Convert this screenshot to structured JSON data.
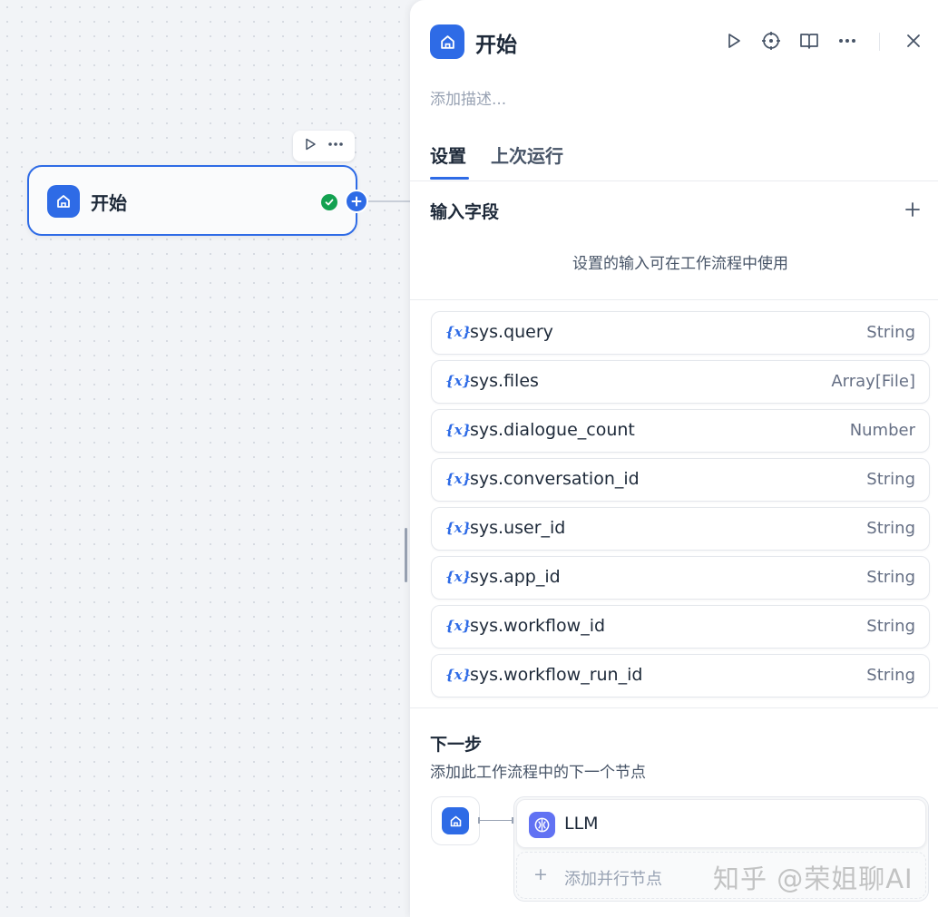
{
  "canvas": {
    "node_title": "开始"
  },
  "panel": {
    "title": "开始",
    "description_placeholder": "添加描述...",
    "tabs": [
      {
        "label": "设置",
        "active": true
      },
      {
        "label": "上次运行",
        "active": false
      }
    ],
    "input_section": {
      "title": "输入字段",
      "hint": "设置的输入可在工作流程中使用"
    },
    "variables": [
      {
        "icon": "{x}",
        "name": "sys.query",
        "type": "String"
      },
      {
        "icon": "{x}",
        "name": "sys.files",
        "type": "Array[File]"
      },
      {
        "icon": "{x}",
        "name": "sys.dialogue_count",
        "type": "Number"
      },
      {
        "icon": "{x}",
        "name": "sys.conversation_id",
        "type": "String"
      },
      {
        "icon": "{x}",
        "name": "sys.user_id",
        "type": "String"
      },
      {
        "icon": "{x}",
        "name": "sys.app_id",
        "type": "String"
      },
      {
        "icon": "{x}",
        "name": "sys.workflow_id",
        "type": "String"
      },
      {
        "icon": "{x}",
        "name": "sys.workflow_run_id",
        "type": "String"
      }
    ],
    "next_step": {
      "title": "下一步",
      "description": "添加此工作流程中的下一个节点",
      "next_node": "LLM",
      "add_parallel_label": "添加并行节点"
    }
  },
  "watermark": "知乎 @荣姐聊AI",
  "colors": {
    "accent": "#2e6be6",
    "success": "#12a150",
    "llm": "#6172f3"
  }
}
